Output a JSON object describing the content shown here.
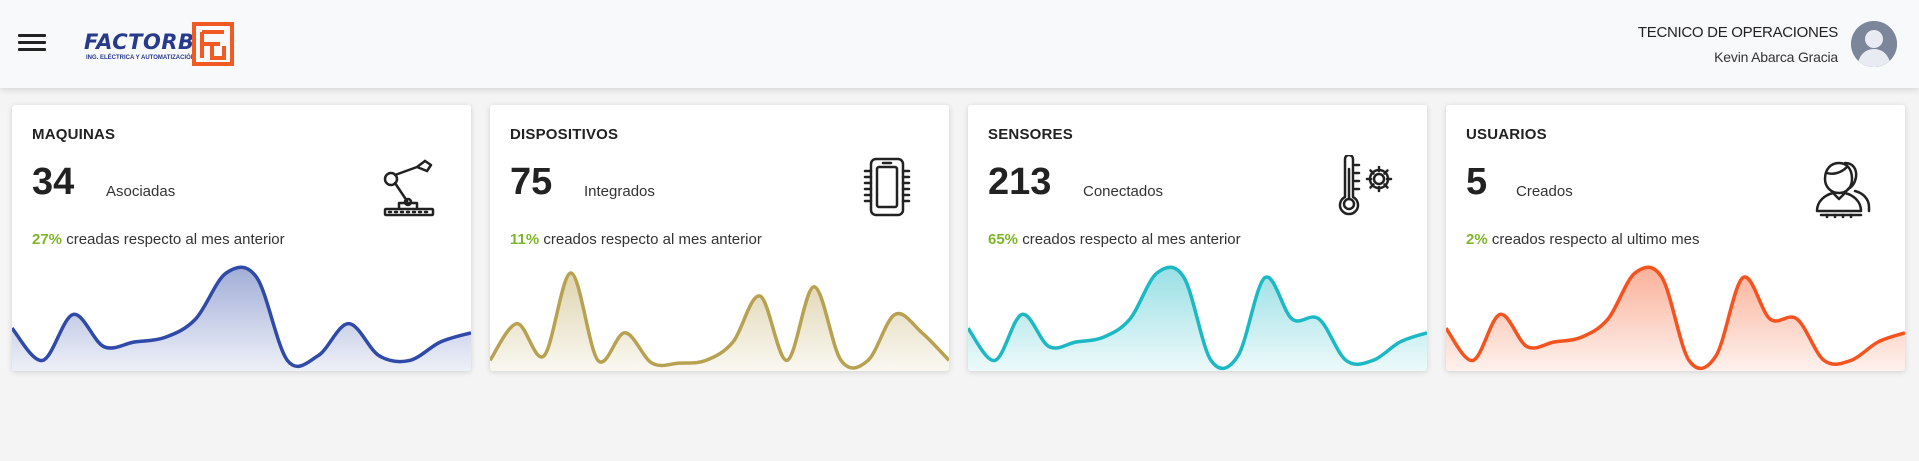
{
  "header": {
    "logo_text": "FACTORB",
    "logo_subtitle": "ING. ELÉCTRICA Y AUTOMATIZACIÓN",
    "user_role": "TECNICO DE OPERACIONES",
    "user_name": "Kevin Abarca Gracia",
    "menu_icon": "hamburger-menu-icon",
    "avatar_icon": "user-avatar-icon"
  },
  "cards": [
    {
      "title": "MAQUINAS",
      "value": "34",
      "value_label": "Asociadas",
      "percent": "27%",
      "stat_text": "creadas respecto al mes anterior",
      "icon": "robot-arm-icon",
      "color": "#2f4aa8",
      "fill": "#c9cfe9",
      "series": [
        0.4,
        0.05,
        0.55,
        0.2,
        0.25,
        0.3,
        0.5,
        1.0,
        0.95,
        0.05,
        0.1,
        0.45,
        0.1,
        0.05,
        0.25,
        0.35
      ]
    },
    {
      "title": "DISPOSITIVOS",
      "value": "75",
      "value_label": "Integrados",
      "percent": "11%",
      "stat_text": "creados respecto al mes anterior",
      "icon": "microchip-device-icon",
      "color": "#b8a150",
      "fill": "#ece4cc",
      "series": [
        0.05,
        0.45,
        0.1,
        1.0,
        0.05,
        0.35,
        0.02,
        0.02,
        0.05,
        0.25,
        0.75,
        0.05,
        0.85,
        0.05,
        0.05,
        0.55,
        0.35,
        0.05
      ]
    },
    {
      "title": "SENSORES",
      "value": "213",
      "value_label": "Conectados",
      "percent": "65%",
      "stat_text": "creados respecto al mes anterior",
      "icon": "thermometer-gear-icon",
      "color": "#1cb8c4",
      "fill": "#bfe9ec",
      "series": [
        0.4,
        0.05,
        0.55,
        0.2,
        0.25,
        0.3,
        0.5,
        1.0,
        0.95,
        0.05,
        0.1,
        0.95,
        0.5,
        0.5,
        0.05,
        0.05,
        0.25,
        0.35
      ]
    },
    {
      "title": "USUARIOS",
      "value": "5",
      "value_label": "Creados",
      "percent": "2%",
      "stat_text": "creados respecto al ultimo mes",
      "icon": "user-group-icon",
      "color": "#f4521e",
      "fill": "#fbc9b6",
      "series": [
        0.4,
        0.05,
        0.55,
        0.2,
        0.25,
        0.3,
        0.5,
        1.0,
        0.95,
        0.05,
        0.1,
        0.95,
        0.5,
        0.5,
        0.05,
        0.05,
        0.25,
        0.35
      ]
    }
  ]
}
